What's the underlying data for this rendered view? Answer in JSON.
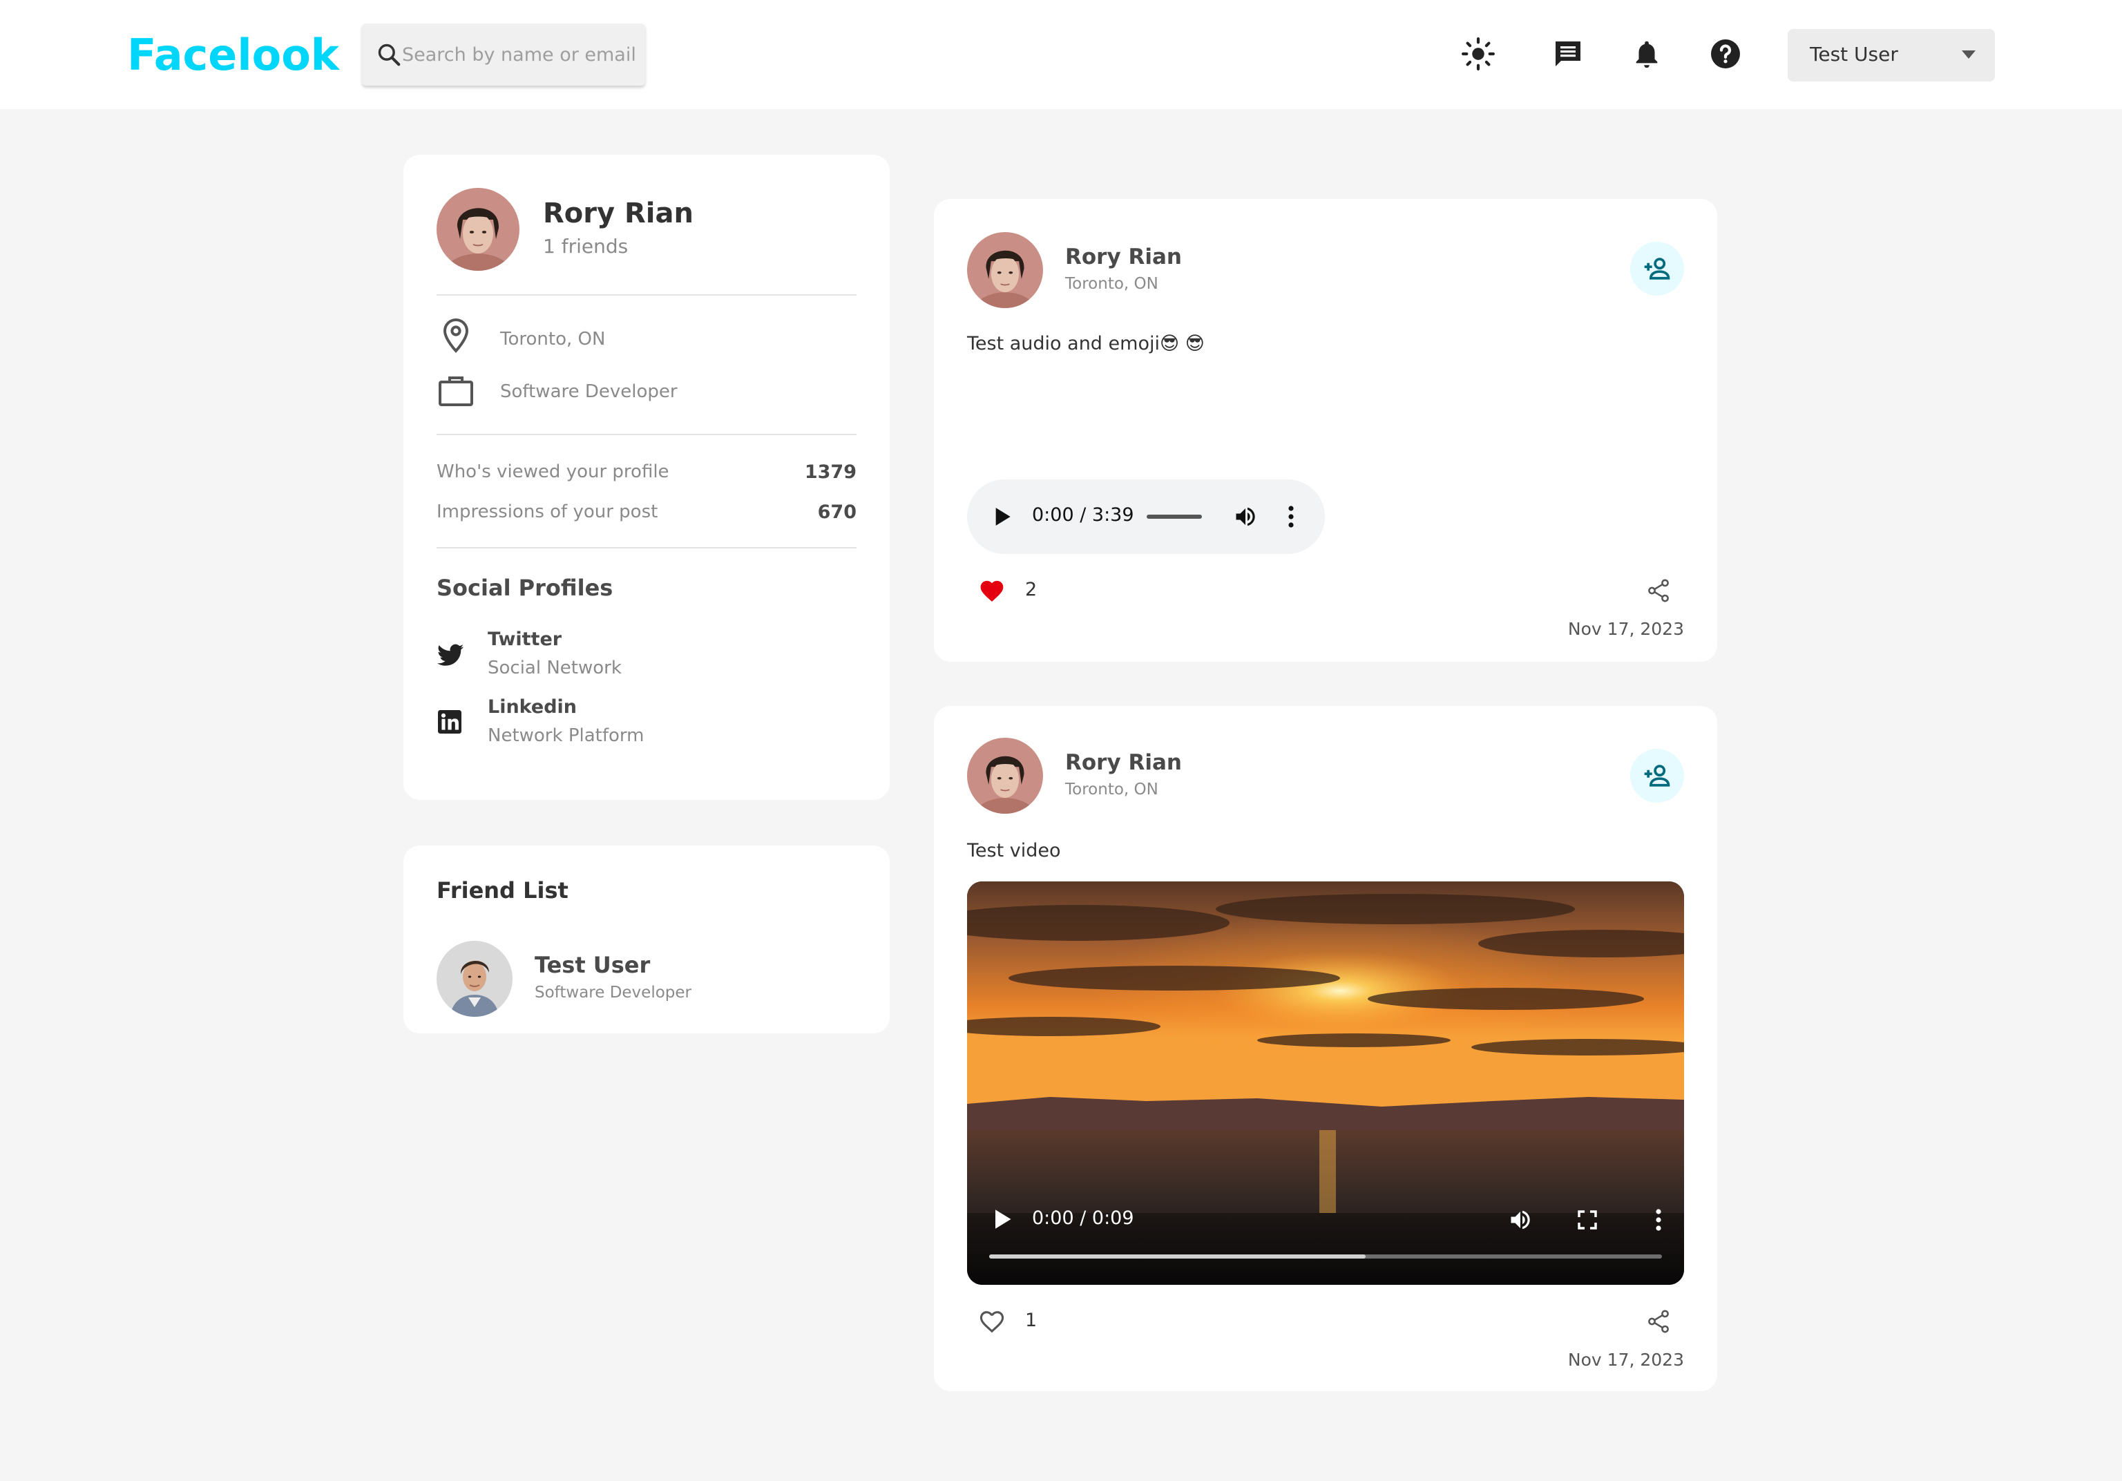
{
  "app": {
    "logo": "Facelook"
  },
  "navbar": {
    "search_placeholder": "Search by name or email",
    "icons": [
      "light-mode-icon",
      "message-icon",
      "notification-bell-icon",
      "help-icon"
    ],
    "user_select": {
      "selected": "Test User"
    }
  },
  "profile": {
    "name": "Rory Rian",
    "friends": "1 friends",
    "location": "Toronto, ON",
    "occupation": "Software Developer",
    "stats": [
      {
        "label": "Who's viewed your profile",
        "value": "1379"
      },
      {
        "label": "Impressions of your post",
        "value": "670"
      }
    ],
    "social_title": "Social Profiles",
    "social": [
      {
        "name": "Twitter",
        "desc": "Social Network",
        "icon": "twitter-icon"
      },
      {
        "name": "Linkedin",
        "desc": "Network Platform",
        "icon": "linkedin-icon"
      }
    ]
  },
  "friend_list": {
    "title": "Friend List",
    "friends": [
      {
        "name": "Test User",
        "occupation": "Software Developer"
      }
    ]
  },
  "posts": [
    {
      "author": "Rory Rian",
      "location": "Toronto, ON",
      "text": "Test audio and emoji😎 😎",
      "media": {
        "type": "audio",
        "time": "0:00 / 3:39"
      },
      "likes": "2",
      "liked": true,
      "date": "Nov 17, 2023"
    },
    {
      "author": "Rory Rian",
      "location": "Toronto, ON",
      "text": "Test video",
      "media": {
        "type": "video",
        "time": "0:00 / 0:09",
        "buffered_fraction": 0.56
      },
      "likes": "1",
      "liked": false,
      "date": "Nov 17, 2023"
    }
  ],
  "colors": {
    "brand": "#00d5fa",
    "like": "#e4000f",
    "add_friend_bg": "#e6fbff",
    "add_friend_icon": "#006b7d"
  }
}
